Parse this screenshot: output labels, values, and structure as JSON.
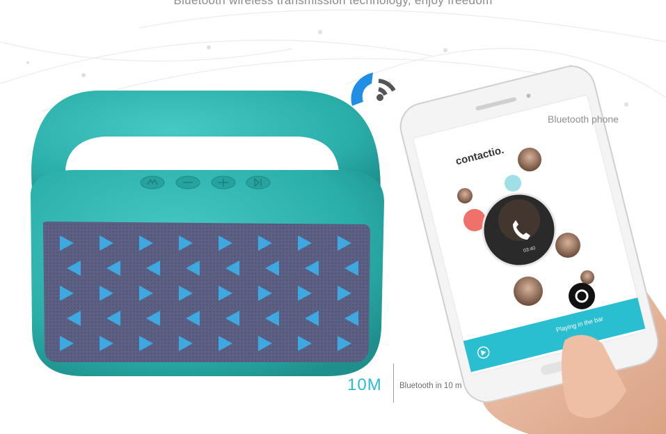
{
  "headline": "Bluetooth wireless transmission technology, enjoy freedom",
  "callout_phone": "Bluetooth phone",
  "range": {
    "value": "10M",
    "description": "Bluetooth in 10 m"
  },
  "phone_screen": {
    "app_title": "contactio.",
    "call_timer": "03:40",
    "bottom_bar_text": "Playing in the bar"
  },
  "icons": [
    "wifi-phone-icon",
    "mode-button-icon",
    "minus-button-icon",
    "plus-button-icon",
    "play-pause-button-icon",
    "phone-handset-icon",
    "record-icon",
    "play-circle-icon"
  ],
  "colors": {
    "speaker_body": "#2fb8b4",
    "grille": "#5a5f80",
    "triangle": "#3ea8e0",
    "accent_cyan": "#29bfd0",
    "wifi_blue": "#1f8fe6",
    "contact_red": "#f0706a"
  }
}
